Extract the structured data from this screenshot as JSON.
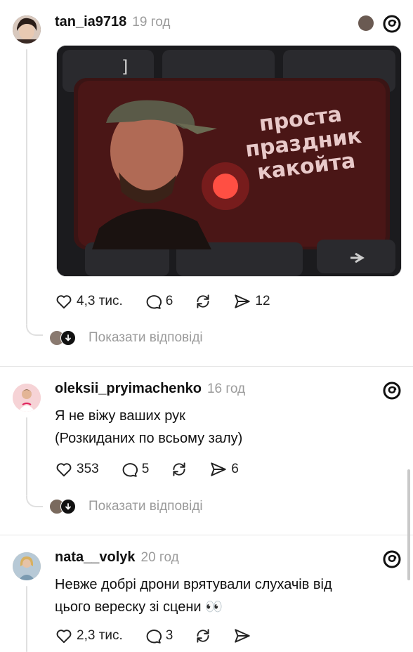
{
  "posts": [
    {
      "username": "tan_ia9718",
      "time": "19 год",
      "avatar_color": "#4a3a33",
      "liked_by_author": true,
      "image": {
        "caption_lines": [
          "проста",
          "праздник",
          "какойта"
        ],
        "description_colors": {
          "key": "#3a1414",
          "glow": "#ff3030",
          "keyboard": "#1b1b1e"
        }
      },
      "actions": {
        "likes": "4,3 тис.",
        "comments": "6",
        "reposts": "",
        "shares": "12"
      },
      "show_replies": "Показати відповіді"
    },
    {
      "username": "oleksii_pryimachenko",
      "time": "16 год",
      "avatar_color": "#f3c9c9",
      "text_lines": [
        "Я не віжу ваших рук",
        "(Розкиданих по всьому залу)"
      ],
      "actions": {
        "likes": "353",
        "comments": "5",
        "reposts": "",
        "shares": "6"
      },
      "show_replies": "Показати відповіді"
    },
    {
      "username": "nata__volyk",
      "time": "20 год",
      "avatar_color": "#c9b79a",
      "text_lines": [
        "Невже добрі дрони врятували слухачів від",
        "цього вереску зі сцени 👀"
      ],
      "actions": {
        "likes": "2,3 тис.",
        "comments": "3",
        "reposts": "",
        "shares": ""
      }
    }
  ],
  "icons": {
    "like": "heart-icon",
    "comment": "comment-bubble-icon",
    "repost": "repost-icon",
    "share": "send-icon",
    "app": "threads-logo-icon"
  },
  "colors": {
    "accent_like": "#e0245e",
    "muted": "#9b9b9b",
    "line": "#e0e0e0"
  }
}
